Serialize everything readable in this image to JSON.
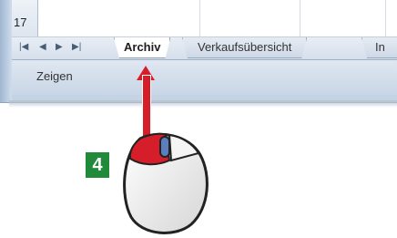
{
  "spreadsheet": {
    "row_number": "17",
    "sheet_tabs": [
      "Archiv",
      "Verkaufsübersicht",
      "In"
    ],
    "nav_arrows": [
      "|◀",
      "◀",
      "▶",
      "▶|"
    ],
    "status_label": "Zeigen"
  },
  "instruction": {
    "step_number": "4",
    "colors": {
      "arrow": "#d51e2a",
      "badge": "#1f8b3a",
      "mouse_button": "#d51e2a"
    }
  }
}
